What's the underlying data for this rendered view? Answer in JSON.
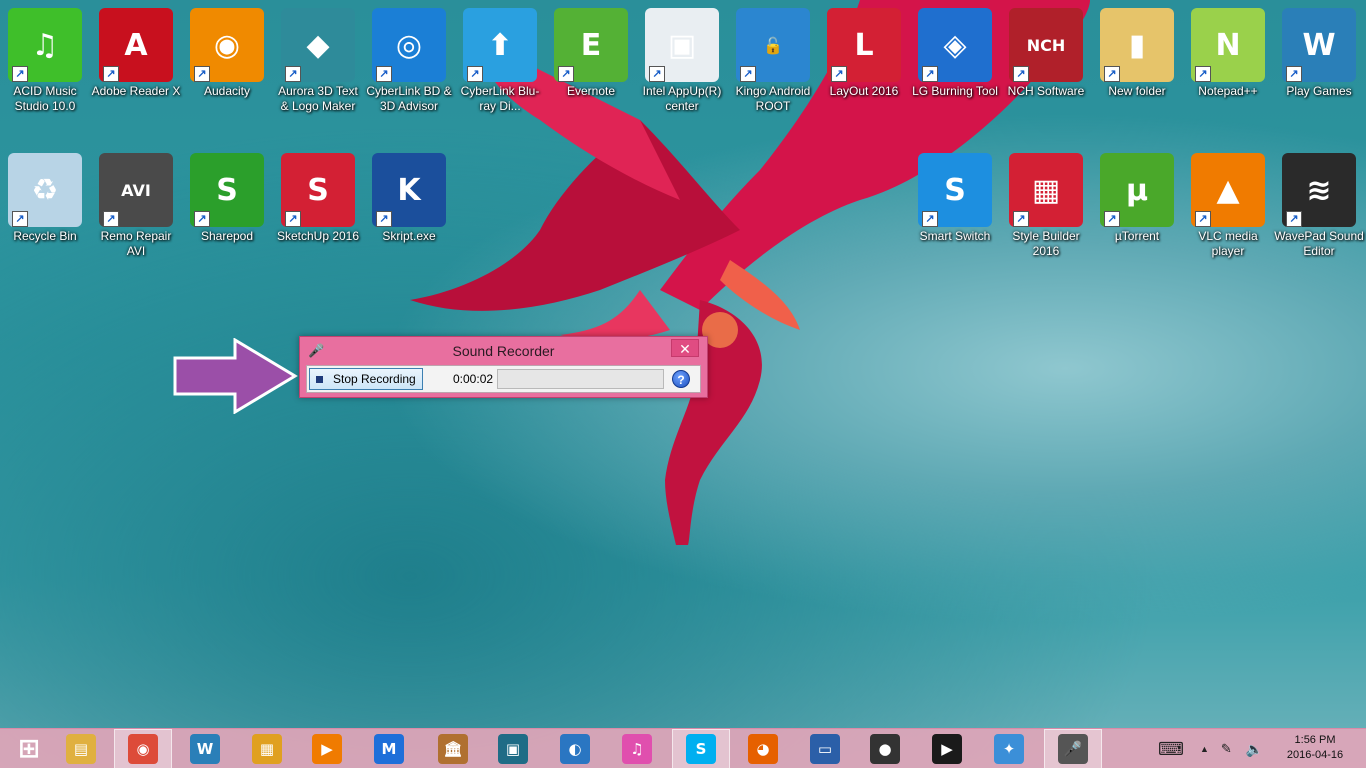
{
  "desktop": {
    "row1": [
      {
        "label": "ACID Music Studio 10.0",
        "icon": "acid-music-icon",
        "color": "#3fbf2a",
        "glyph": "♫"
      },
      {
        "label": "Adobe Reader X",
        "icon": "adobe-reader-icon",
        "color": "#c8101e",
        "glyph": "A"
      },
      {
        "label": "Audacity",
        "icon": "audacity-icon",
        "color": "#f08a00",
        "glyph": "◉"
      },
      {
        "label": "Aurora 3D Text & Logo Maker",
        "icon": "aurora-3d-icon",
        "color": "#2e8b9a",
        "glyph": "◆"
      },
      {
        "label": "CyberLink BD & 3D Advisor",
        "icon": "cyberlink-bd-icon",
        "color": "#1b7fd6",
        "glyph": "◎"
      },
      {
        "label": "CyberLink Blu-ray Di...",
        "icon": "cyberlink-bluray-icon",
        "color": "#2aa0e0",
        "glyph": "⬆"
      },
      {
        "label": "Evernote",
        "icon": "evernote-icon",
        "color": "#54b135",
        "glyph": "E"
      },
      {
        "label": "Intel AppUp(R) center",
        "icon": "intel-appup-icon",
        "color": "#e9eef2",
        "glyph": "▣"
      },
      {
        "label": "Kingo Android ROOT",
        "icon": "kingo-root-icon",
        "color": "#2b86d0",
        "glyph": "🔓"
      },
      {
        "label": "LayOut 2016",
        "icon": "layout-icon",
        "color": "#d32034",
        "glyph": "L"
      },
      {
        "label": "LG Burning Tool",
        "icon": "lg-burning-icon",
        "color": "#1f6fcf",
        "glyph": "◈"
      },
      {
        "label": "NCH Software",
        "icon": "nch-software-icon",
        "color": "#b0202a",
        "glyph": "NCH"
      },
      {
        "label": "New folder",
        "icon": "folder-icon",
        "color": "#e6c46a",
        "glyph": "▮"
      },
      {
        "label": "Notepad++",
        "icon": "notepadpp-icon",
        "color": "#9ad14b",
        "glyph": "N"
      },
      {
        "label": "Play Games",
        "icon": "play-games-icon",
        "color": "#2a7fb8",
        "glyph": "W"
      }
    ],
    "row2": [
      {
        "label": "Recycle Bin",
        "icon": "recycle-bin-icon",
        "color": "#b8d4e6",
        "glyph": "♻"
      },
      {
        "label": "Remo Repair AVI",
        "icon": "remo-repair-icon",
        "color": "#4a4a4a",
        "glyph": "AVI"
      },
      {
        "label": "Sharepod",
        "icon": "sharepod-icon",
        "color": "#2b9f2b",
        "glyph": "S"
      },
      {
        "label": "SketchUp 2016",
        "icon": "sketchup-icon",
        "color": "#d32034",
        "glyph": "S"
      },
      {
        "label": "Skript.exe",
        "icon": "skript-icon",
        "color": "#1b4f9c",
        "glyph": "K"
      }
    ],
    "row2right": [
      {
        "label": "Smart Switch",
        "icon": "smart-switch-icon",
        "color": "#1d8fe0",
        "glyph": "S"
      },
      {
        "label": "Style Builder 2016",
        "icon": "style-builder-icon",
        "color": "#d32034",
        "glyph": "▦"
      },
      {
        "label": "µTorrent",
        "icon": "utorrent-icon",
        "color": "#4aa82a",
        "glyph": "µ"
      },
      {
        "label": "VLC media player",
        "icon": "vlc-icon",
        "color": "#f07b00",
        "glyph": "▲"
      },
      {
        "label": "WavePad Sound Editor",
        "icon": "wavepad-icon",
        "color": "#2a2a2a",
        "glyph": "≋"
      }
    ]
  },
  "recorder": {
    "title": "Sound Recorder",
    "stop_label": "Stop Recording",
    "elapsed": "0:00:02",
    "close_glyph": "✕",
    "help_glyph": "?",
    "level": 0
  },
  "taskbar": {
    "items": [
      {
        "name": "start-button",
        "icon": "windows-logo-icon",
        "glyph": "⊞",
        "color": "#1a1a1a"
      },
      {
        "name": "file-explorer",
        "icon": "file-explorer-icon",
        "glyph": "▤",
        "color": "#e0b040"
      },
      {
        "name": "chrome",
        "icon": "chrome-icon",
        "glyph": "◉",
        "color": "#dd4b39",
        "active": true
      },
      {
        "name": "play-games",
        "icon": "play-games-icon",
        "glyph": "W",
        "color": "#2a7fb8"
      },
      {
        "name": "store",
        "icon": "store-icon",
        "glyph": "▦",
        "color": "#e0a020"
      },
      {
        "name": "video-player",
        "icon": "video-player-icon",
        "glyph": "▶",
        "color": "#f07b00"
      },
      {
        "name": "malwarebytes",
        "icon": "malwarebytes-icon",
        "glyph": "M",
        "color": "#1e6fd9"
      },
      {
        "name": "library",
        "icon": "library-icon",
        "glyph": "🏛",
        "color": "#b07030"
      },
      {
        "name": "media-player",
        "icon": "film-icon",
        "glyph": "▣",
        "color": "#1f6c86"
      },
      {
        "name": "bird-app",
        "icon": "bird-icon",
        "glyph": "◐",
        "color": "#2a76c2"
      },
      {
        "name": "itunes",
        "icon": "itunes-icon",
        "glyph": "♫",
        "color": "#e04fae"
      },
      {
        "name": "skype",
        "icon": "skype-icon",
        "glyph": "S",
        "color": "#00aff0",
        "active": true
      },
      {
        "name": "firefox",
        "icon": "firefox-icon",
        "glyph": "◕",
        "color": "#e66000"
      },
      {
        "name": "remote-desktop",
        "icon": "remote-desktop-icon",
        "glyph": "▭",
        "color": "#2b5fa8"
      },
      {
        "name": "webcam",
        "icon": "webcam-icon",
        "glyph": "●",
        "color": "#333333"
      },
      {
        "name": "media-center",
        "icon": "media-center-icon",
        "glyph": "▶",
        "color": "#1a1a1a"
      },
      {
        "name": "safari",
        "icon": "safari-icon",
        "glyph": "✦",
        "color": "#3b8fd8"
      },
      {
        "name": "sound-recorder",
        "icon": "microphone-icon",
        "glyph": "🎤",
        "color": "#555555",
        "active": true
      }
    ],
    "clock_time": "1:56 PM",
    "clock_date": "2016-04-16"
  },
  "colors": {
    "taskbar": "#e1a5b9",
    "recorder_frame": "#e86f9f",
    "arrow": "#9b4fa8"
  }
}
